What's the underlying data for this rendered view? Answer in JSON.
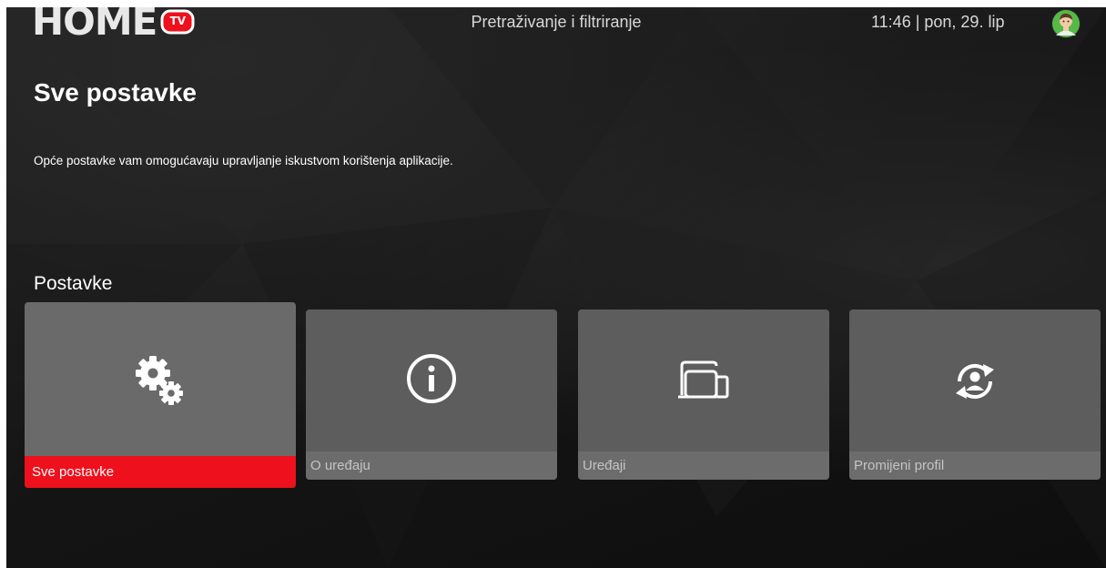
{
  "header": {
    "logo_text": "HOME",
    "logo_badge": "TV",
    "title": "Pretraživanje i filtriranje",
    "clock": "11:46 | pon, 29. lip"
  },
  "page": {
    "title": "Sve postavke",
    "description": "Opće postavke vam omogućavaju upravljanje iskustvom korištenja aplikacije.",
    "section_title": "Postavke"
  },
  "tiles": [
    {
      "label": "Sve postavke",
      "icon": "gears-icon",
      "selected": true
    },
    {
      "label": "O uređaju",
      "icon": "info-icon",
      "selected": false
    },
    {
      "label": "Uređaji",
      "icon": "devices-icon",
      "selected": false
    },
    {
      "label": "Promijeni profil",
      "icon": "switch-profile-icon",
      "selected": false
    }
  ],
  "colors": {
    "accent": "#ee101c",
    "tile": "#5d5d5d",
    "tile_label_bar": "#6c6c6c",
    "background": "#161616"
  }
}
